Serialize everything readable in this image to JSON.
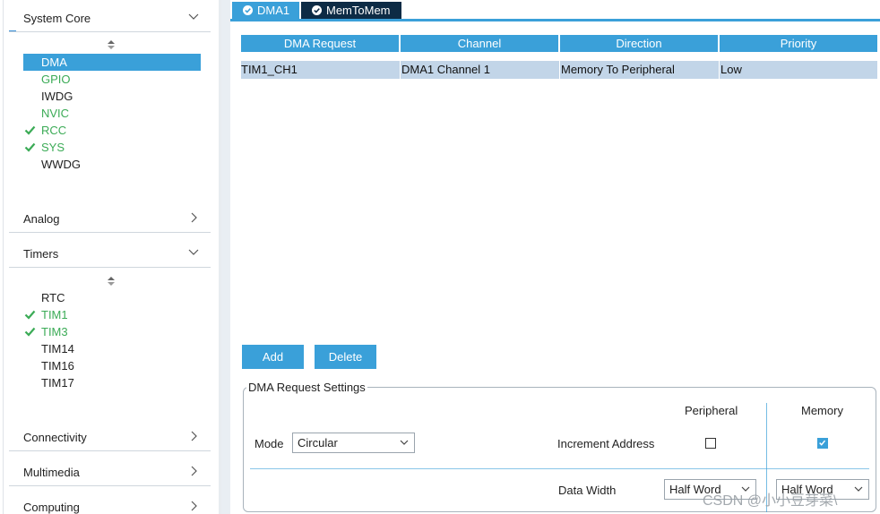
{
  "sidebar": {
    "sections": {
      "system_core": "System Core",
      "analog": "Analog",
      "timers": "Timers",
      "connectivity": "Connectivity",
      "multimedia": "Multimedia",
      "computing": "Computing"
    },
    "system_core_items": [
      {
        "label": "DMA",
        "state": "selected"
      },
      {
        "label": "GPIO",
        "state": "configured"
      },
      {
        "label": "IWDG",
        "state": "normal"
      },
      {
        "label": "NVIC",
        "state": "configured"
      },
      {
        "label": "RCC",
        "state": "checked"
      },
      {
        "label": "SYS",
        "state": "checked"
      },
      {
        "label": "WWDG",
        "state": "normal"
      }
    ],
    "timers_items": [
      {
        "label": "RTC",
        "state": "normal"
      },
      {
        "label": "TIM1",
        "state": "checked"
      },
      {
        "label": "TIM3",
        "state": "checked"
      },
      {
        "label": "TIM14",
        "state": "normal"
      },
      {
        "label": "TIM16",
        "state": "normal"
      },
      {
        "label": "TIM17",
        "state": "normal"
      }
    ]
  },
  "tabs": [
    {
      "label": "DMA1",
      "icon": "check-circle-icon"
    },
    {
      "label": "MemToMem",
      "icon": "check-circle-icon"
    }
  ],
  "table": {
    "headers": [
      "DMA Request",
      "Channel",
      "Direction",
      "Priority"
    ],
    "rows": [
      [
        "TIM1_CH1",
        "DMA1 Channel 1",
        "Memory To Peripheral",
        "Low"
      ]
    ]
  },
  "buttons": {
    "add": "Add",
    "delete": "Delete"
  },
  "settings": {
    "title": "DMA Request Settings",
    "peripheral_header": "Peripheral",
    "memory_header": "Memory",
    "mode_label": "Mode",
    "mode_value": "Circular",
    "increment_label": "Increment Address",
    "peripheral_increment": false,
    "memory_increment": true,
    "data_width_label": "Data Width",
    "peripheral_width": "Half Word",
    "memory_width": "Half Word"
  },
  "watermark": "CSDN @小小豆芽菜\\",
  "colors": {
    "accent": "#3aa0d9",
    "configured": "#3bab56",
    "active_tab": "#0d2b45",
    "row_selected": "#c2d5e8"
  }
}
